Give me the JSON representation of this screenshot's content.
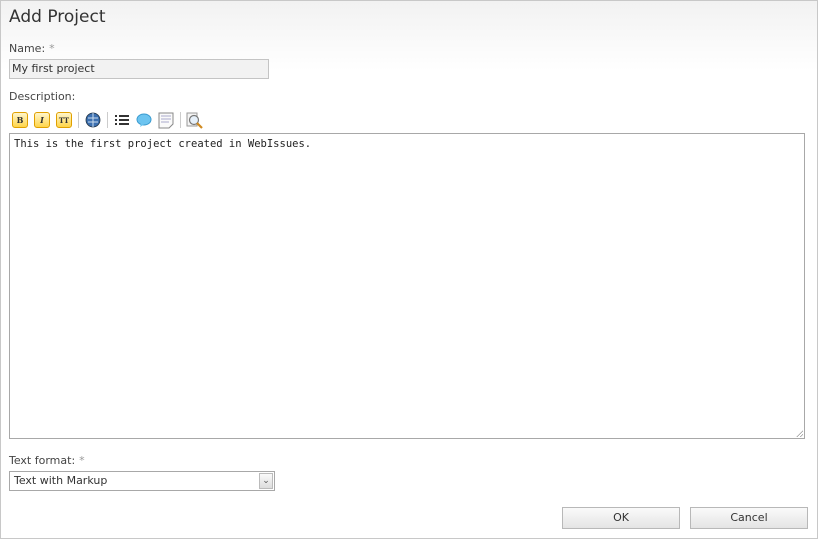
{
  "dialog": {
    "title": "Add Project"
  },
  "name": {
    "label": "Name:",
    "required_mark": "*",
    "value": "My first project"
  },
  "description": {
    "label": "Description:",
    "value": "This is the first project created in WebIssues.",
    "toolbar": [
      {
        "name": "bold",
        "glyph": "B"
      },
      {
        "name": "italic",
        "glyph": "I"
      },
      {
        "name": "monospace",
        "glyph": "TT"
      },
      {
        "name": "link-icon"
      },
      {
        "name": "list-icon"
      },
      {
        "name": "quote-icon"
      },
      {
        "name": "code-block-icon"
      },
      {
        "name": "preview-icon"
      }
    ]
  },
  "text_format": {
    "label": "Text format:",
    "required_mark": "*",
    "selected": "Text with Markup"
  },
  "buttons": {
    "ok": "OK",
    "cancel": "Cancel"
  }
}
